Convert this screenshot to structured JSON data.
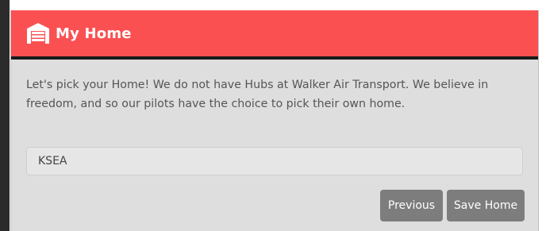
{
  "modal": {
    "title": "My Home",
    "icon": "garage-icon",
    "accent_color": "#fb5052",
    "description": "Let's pick your Home! We do not have Hubs at Walker Air Transport. We believe in freedom, and so our pilots have the choice to pick their own home.",
    "home_input": {
      "value": "KSEA",
      "placeholder": ""
    },
    "buttons": {
      "previous_label": "Previous",
      "save_label": "Save Home"
    }
  }
}
